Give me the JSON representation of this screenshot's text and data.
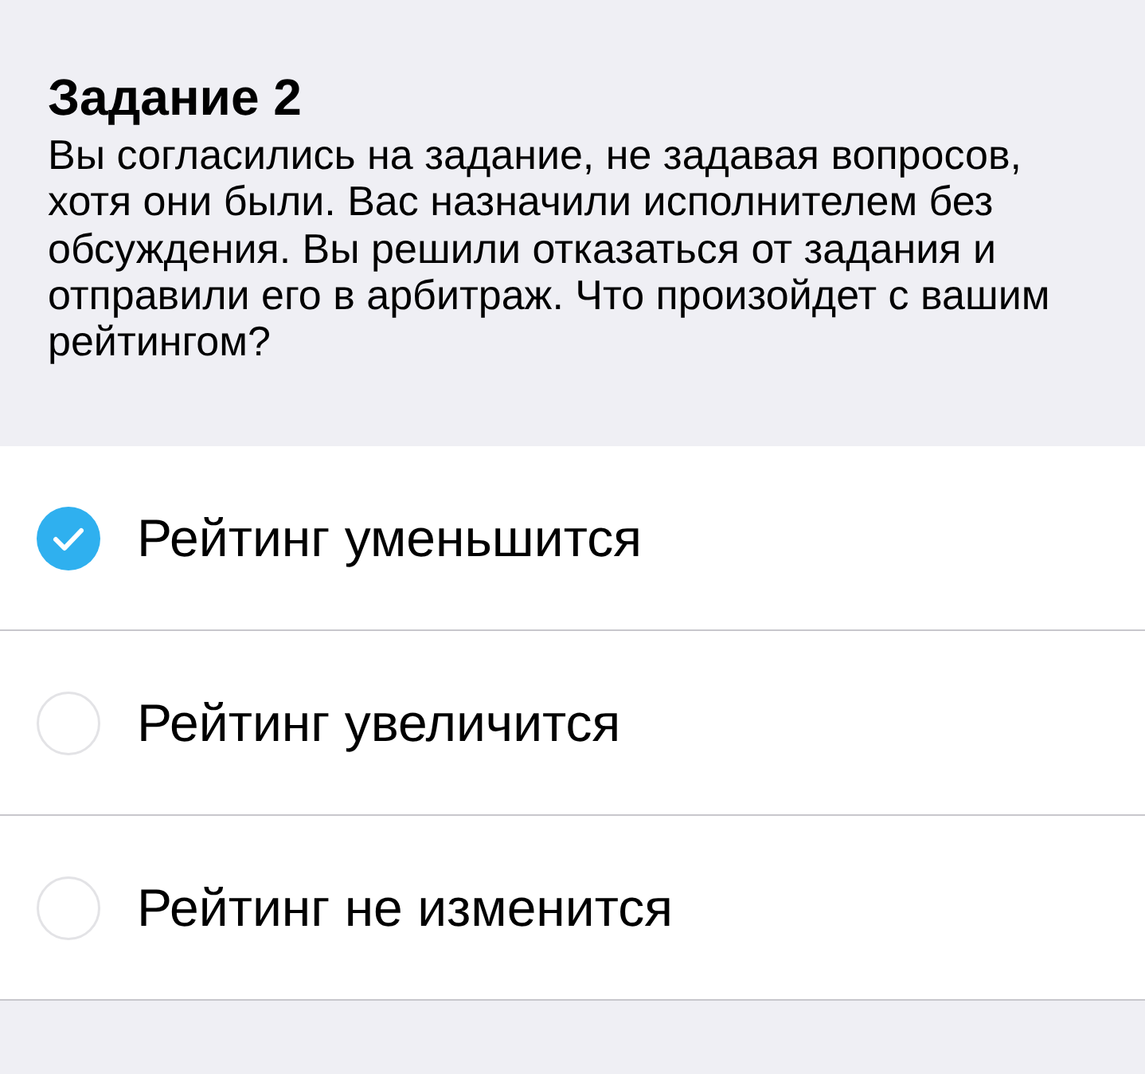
{
  "task": {
    "title": "Задание 2",
    "question": "Вы согласились на задание, не задавая вопросов, хотя они были. Вас назначили исполнителем без обсуждения. Вы решили отказаться от задания и отправили его в арбитраж. Что произойдет с вашим рейтингом?"
  },
  "options": [
    {
      "label": "Рейтинг уменьшится",
      "selected": true
    },
    {
      "label": "Рейтинг увеличится",
      "selected": false
    },
    {
      "label": "Рейтинг не изменится",
      "selected": false
    }
  ]
}
